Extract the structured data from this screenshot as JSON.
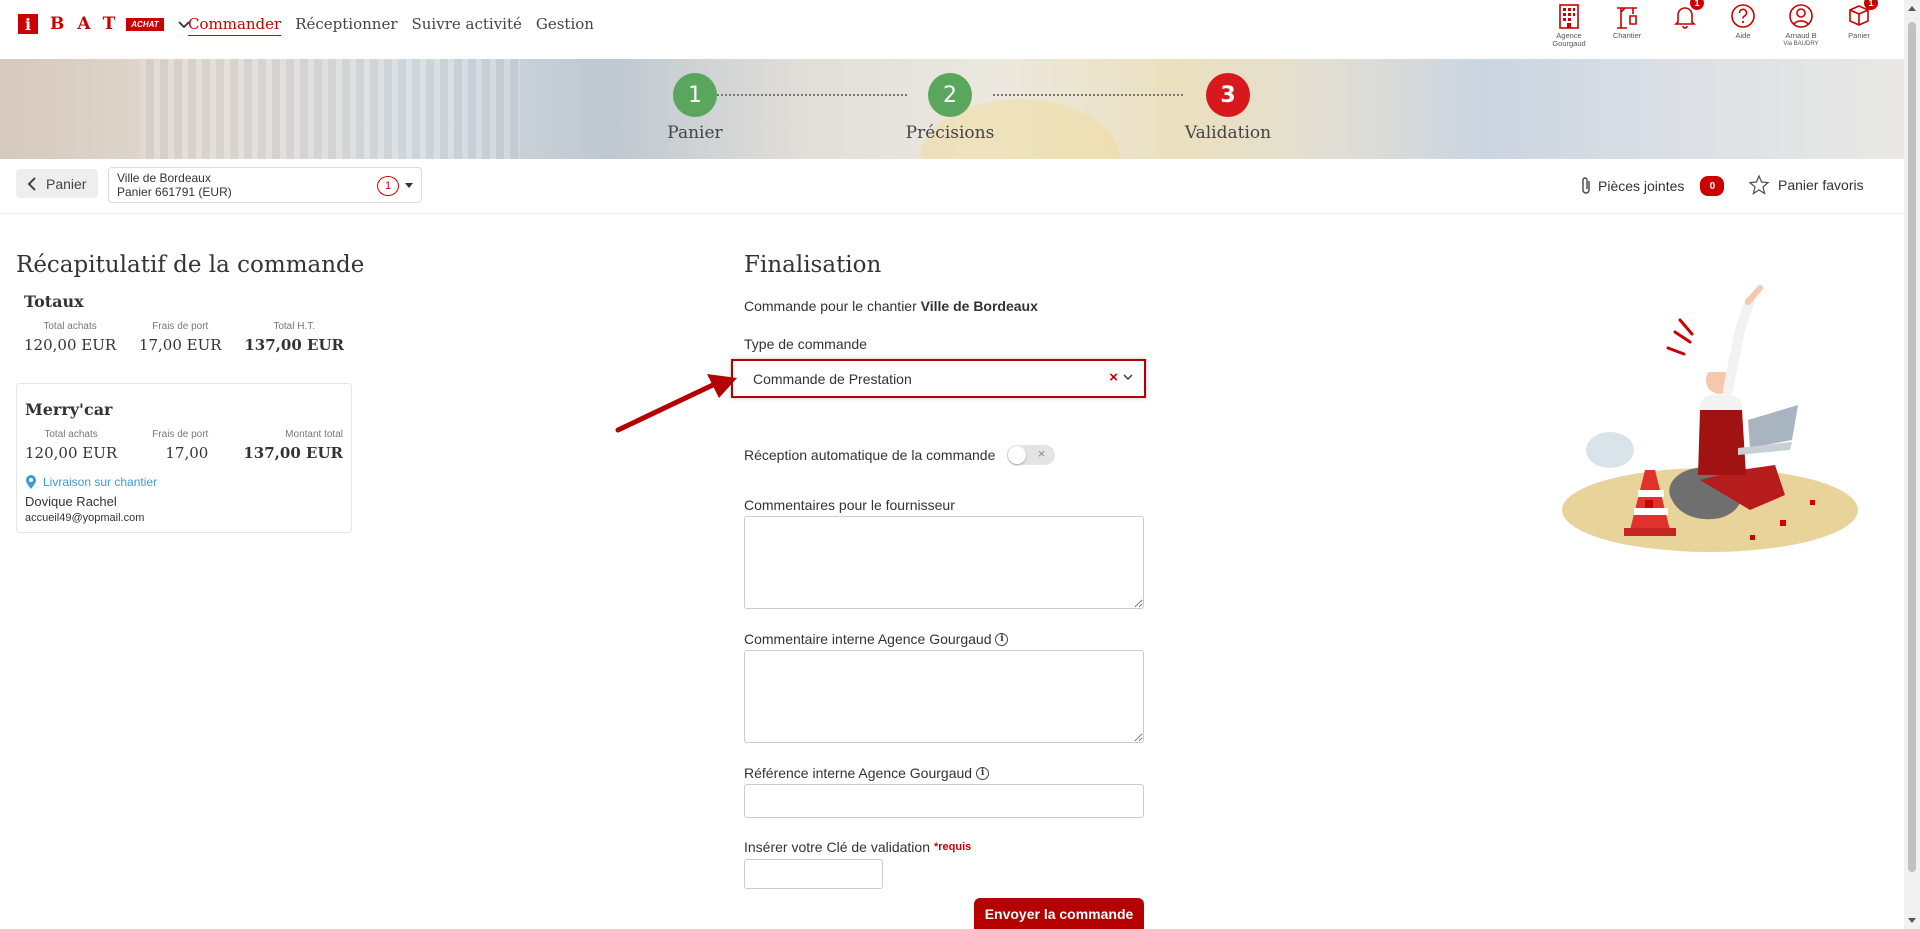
{
  "brand": {
    "logo_i": "i",
    "letters": "BAT",
    "badge": "ACHAT"
  },
  "nav": {
    "items": [
      {
        "label": "Commander",
        "active": true
      },
      {
        "label": "Réceptionner",
        "active": false
      },
      {
        "label": "Suivre activité",
        "active": false
      },
      {
        "label": "Gestion",
        "active": false
      }
    ]
  },
  "top_icons": [
    {
      "icon": "building-icon",
      "label": "Agence Gourgaud",
      "badge": ""
    },
    {
      "icon": "crane-icon",
      "label": "Chantier",
      "badge": ""
    },
    {
      "icon": "bell-icon",
      "label": "",
      "badge": "1"
    },
    {
      "icon": "help-icon",
      "label": "Aide",
      "badge": ""
    },
    {
      "icon": "user-icon",
      "label": "Arnaud B",
      "sublabel": "Via BAUDRY",
      "badge": ""
    },
    {
      "icon": "cart-icon",
      "label": "Panier",
      "badge": "1"
    }
  ],
  "steps": [
    {
      "number": "1",
      "label": "Panier",
      "color": "#5aa65c"
    },
    {
      "number": "2",
      "label": "Précisions",
      "color": "#5aa65c"
    },
    {
      "number": "3",
      "label": "Validation",
      "color": "#d7191e"
    }
  ],
  "subbar": {
    "back_label": "Panier",
    "cart_site": "Ville de Bordeaux",
    "cart_name": "Panier 661791 (EUR)",
    "cart_count": "1",
    "attachments_label": "Pièces jointes",
    "attachments_count": "0",
    "favorites_label": "Panier favoris"
  },
  "summary": {
    "title": "Récapitulatif de la commande",
    "totals": {
      "heading": "Totaux",
      "cols": [
        {
          "header": "Total achats",
          "value": "120,00 EUR"
        },
        {
          "header": "Frais de port",
          "value": "17,00 EUR"
        },
        {
          "header": "Total H.T.",
          "value": "137,00 EUR"
        }
      ]
    },
    "supplier": {
      "name": "Merry'car",
      "cols": [
        {
          "header": "Total achats",
          "value": "120,00 EUR"
        },
        {
          "header": "Frais de port",
          "value": "17,00"
        },
        {
          "header": "Montant total",
          "value": "137,00 EUR"
        }
      ],
      "delivery": "Livraison sur chantier",
      "contact_name": "Dovique Rachel",
      "contact_email": "accueil49@yopmail.com"
    }
  },
  "form": {
    "title": "Finalisation",
    "site_prefix": "Commande pour le chantier",
    "site_name": "Ville de Bordeaux",
    "order_type_label": "Type de commande",
    "order_type_value": "Commande de Prestation",
    "auto_reception_label": "Réception automatique de la commande",
    "auto_reception_on": false,
    "supplier_comments_label": "Commentaires pour le fournisseur",
    "internal_comment_label": "Commentaire interne Agence Gourgaud",
    "internal_ref_label": "Référence interne Agence Gourgaud",
    "validation_key_label": "Insérer votre Clé de validation",
    "required_label": "*requis",
    "submit_label": "Envoyer la commande"
  },
  "colors": {
    "accent": "#c00000",
    "step_done": "#5aa65c",
    "step_current": "#d7191e",
    "link": "#3c9ad6"
  }
}
